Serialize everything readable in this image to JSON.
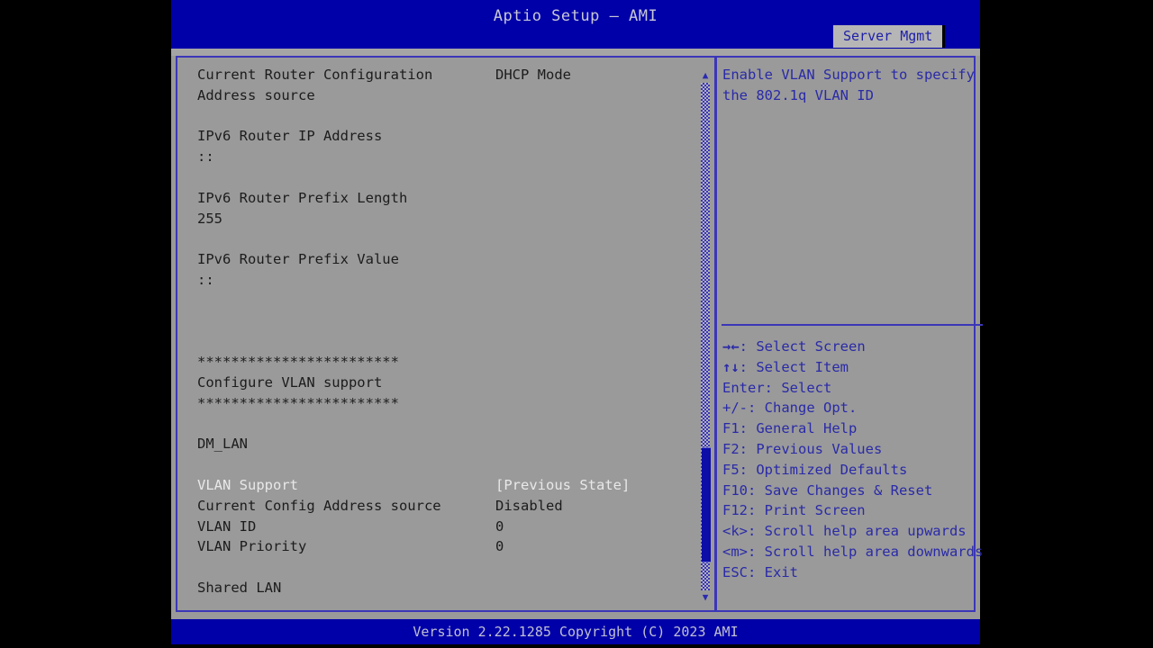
{
  "window": {
    "title": "Aptio Setup – AMI",
    "footer": "Version 2.22.1285 Copyright (C) 2023 AMI"
  },
  "tabs": [
    {
      "label": "Server Mgmt",
      "active": true
    }
  ],
  "colors": {
    "titlebar_blue": "#0000a8",
    "panel_gray": "#9a9a9a",
    "help_blue": "#2a2aa8",
    "border_blue": "#3b36b8",
    "selected_text": "#e8e8e8",
    "normal_text": "#1c1c1c"
  },
  "left_pane": {
    "rows": [
      {
        "label": "Current Router Configuration",
        "value": "DHCP Mode",
        "selected": false
      },
      {
        "label": "Address source",
        "value": "",
        "selected": false
      },
      {
        "label": "",
        "value": "",
        "selected": false
      },
      {
        "label": "IPv6 Router IP Address",
        "value": "",
        "selected": false
      },
      {
        "label": "::",
        "value": "",
        "selected": false
      },
      {
        "label": "",
        "value": "",
        "selected": false
      },
      {
        "label": "IPv6 Router Prefix Length",
        "value": "",
        "selected": false
      },
      {
        "label": "255",
        "value": "",
        "selected": false
      },
      {
        "label": "",
        "value": "",
        "selected": false
      },
      {
        "label": "IPv6 Router Prefix Value",
        "value": "",
        "selected": false
      },
      {
        "label": "::",
        "value": "",
        "selected": false
      },
      {
        "label": "",
        "value": "",
        "selected": false
      },
      {
        "label": "",
        "value": "",
        "selected": false
      },
      {
        "label": "",
        "value": "",
        "selected": false
      },
      {
        "label": "************************",
        "value": "",
        "selected": false
      },
      {
        "label": "Configure VLAN support",
        "value": "",
        "selected": false
      },
      {
        "label": "************************",
        "value": "",
        "selected": false
      },
      {
        "label": "",
        "value": "",
        "selected": false
      },
      {
        "label": "DM_LAN",
        "value": "",
        "selected": false
      },
      {
        "label": "",
        "value": "",
        "selected": false
      },
      {
        "label": "VLAN Support",
        "value": "[Previous State]",
        "selected": true
      },
      {
        "label": "Current Config Address source",
        "value": "Disabled",
        "selected": false
      },
      {
        "label": "VLAN ID",
        "value": "0",
        "selected": false
      },
      {
        "label": "VLAN Priority",
        "value": "0",
        "selected": false
      },
      {
        "label": "",
        "value": "",
        "selected": false
      },
      {
        "label": "Shared LAN",
        "value": "",
        "selected": false
      }
    ]
  },
  "scrollbar": {
    "up_arrow": "▲",
    "down_arrow": "▼"
  },
  "help": {
    "text": "Enable VLAN Support to specify\nthe 802.1q VLAN ID",
    "keys": [
      {
        "glyph": "→←",
        "text": ": Select Screen"
      },
      {
        "glyph": "↑↓",
        "text": ": Select Item"
      },
      {
        "glyph": "",
        "text": "Enter: Select"
      },
      {
        "glyph": "",
        "text": "+/-: Change Opt."
      },
      {
        "glyph": "",
        "text": "F1: General Help"
      },
      {
        "glyph": "",
        "text": "F2: Previous Values"
      },
      {
        "glyph": "",
        "text": "F5: Optimized Defaults"
      },
      {
        "glyph": "",
        "text": "F10: Save Changes & Reset"
      },
      {
        "glyph": "",
        "text": "F12: Print Screen"
      },
      {
        "glyph": "",
        "text": "<k>: Scroll help area upwards"
      },
      {
        "glyph": "",
        "text": "<m>: Scroll help area downwards"
      },
      {
        "glyph": "",
        "text": "ESC: Exit"
      }
    ]
  }
}
